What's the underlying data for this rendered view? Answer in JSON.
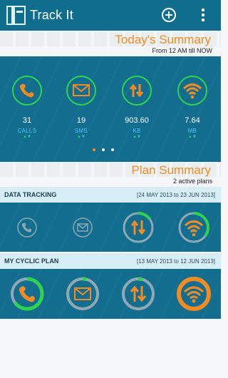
{
  "appbar": {
    "title": "Track It",
    "icons": [
      "app-logo-icon",
      "add-circle-icon",
      "overflow-menu-icon"
    ]
  },
  "today": {
    "title": "Today's Summary",
    "subtitle": "From 12 AM   till NOW",
    "stats": [
      {
        "value": "31",
        "label": "CALLS",
        "icon": "phone-icon"
      },
      {
        "value": "19",
        "label": "SMS",
        "icon": "message-icon"
      },
      {
        "value": "903.60",
        "label": "KB",
        "icon": "data-transfer-icon"
      },
      {
        "value": "7.64",
        "label": "MB",
        "icon": "wifi-icon"
      }
    ],
    "pager": {
      "pages": 3,
      "active": 1
    }
  },
  "plans": {
    "title": "Plan Summary",
    "subtitle": "2 active plans",
    "items": [
      {
        "name": "DATA TRACKING",
        "dates": "[24 MAY 2013 to 23 JUN 2013]",
        "usage": [
          {
            "icon": "phone-icon",
            "fraction": 0
          },
          {
            "icon": "message-icon",
            "fraction": 0
          },
          {
            "icon": "data-transfer-icon",
            "fraction": 0.15
          },
          {
            "icon": "wifi-icon",
            "fraction": 0.35
          }
        ]
      },
      {
        "name": "MY CYCLIC PLAN",
        "dates": "[13 MAY 2013 to 12 JUN 2013]",
        "usage": [
          {
            "icon": "phone-icon",
            "fraction": 0.65
          },
          {
            "icon": "message-icon",
            "fraction": 0.04
          },
          {
            "icon": "data-transfer-icon",
            "fraction": 0.04
          },
          {
            "icon": "wifi-icon",
            "fraction": 1.0
          }
        ]
      }
    ]
  },
  "colors": {
    "primary": "#136d8f",
    "appbar": "#0f6d8e",
    "accent_orange": "#f28b22",
    "ring_green": "#2fd34f",
    "label_blue": "#48c7f0",
    "ring_gray": "#8ea9b4"
  }
}
